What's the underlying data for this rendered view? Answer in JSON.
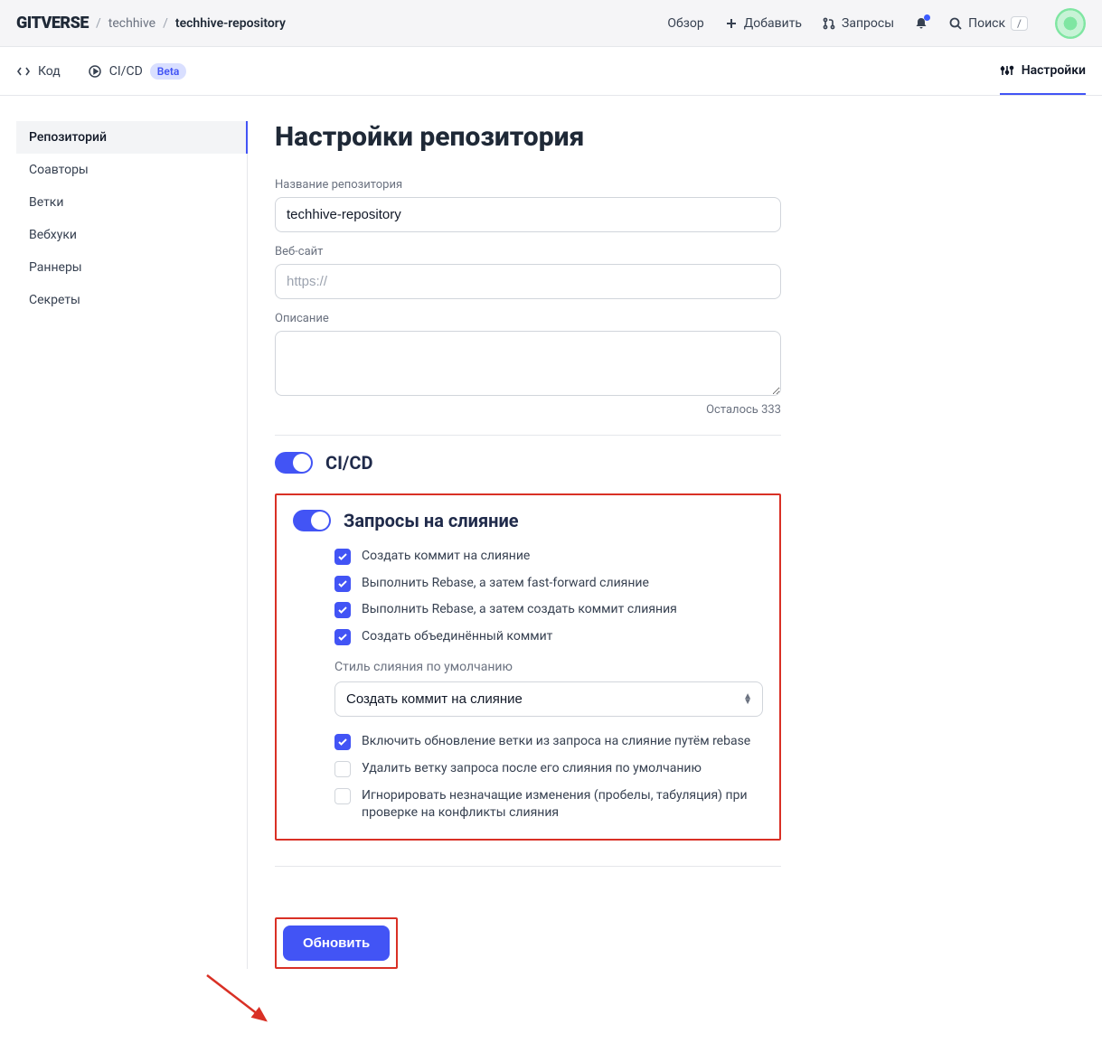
{
  "header": {
    "logo": "GITVERSE",
    "breadcrumb": {
      "owner": "techhive",
      "repo": "techhive-repository"
    },
    "links": {
      "overview": "Обзор",
      "add": "Добавить",
      "requests": "Запросы",
      "search": "Поиск",
      "search_kbd": "/"
    }
  },
  "tabs": {
    "code": "Код",
    "cicd": "CI/CD",
    "beta": "Beta",
    "settings": "Настройки"
  },
  "sidebar": {
    "items": [
      "Репозиторий",
      "Соавторы",
      "Ветки",
      "Вебхуки",
      "Раннеры",
      "Секреты"
    ]
  },
  "page": {
    "title": "Настройки репозитория",
    "fields": {
      "name_label": "Название репозитория",
      "name_value": "techhive-repository",
      "website_label": "Веб-сайт",
      "website_placeholder": "https://",
      "desc_label": "Описание",
      "remaining": "Осталось 333"
    },
    "cicd_toggle": "CI/CD",
    "merge": {
      "title": "Запросы на слияние",
      "opts": [
        "Создать коммит на слияние",
        "Выполнить Rebase, а затем fast-forward слияние",
        "Выполнить Rebase, а затем создать коммит слияния",
        "Создать объединённый коммит"
      ],
      "default_style_label": "Стиль слияния по умолчанию",
      "default_style_value": "Создать коммит на слияние",
      "extra": [
        {
          "label": "Включить обновление ветки из запроса на слияние путём rebase",
          "checked": true
        },
        {
          "label": "Удалить ветку запроса после его слияния по умолчанию",
          "checked": false
        },
        {
          "label": "Игнорировать незначащие изменения (пробелы, табуляция) при проверке на конфликты слияния",
          "checked": false
        }
      ]
    },
    "update_btn": "Обновить"
  }
}
